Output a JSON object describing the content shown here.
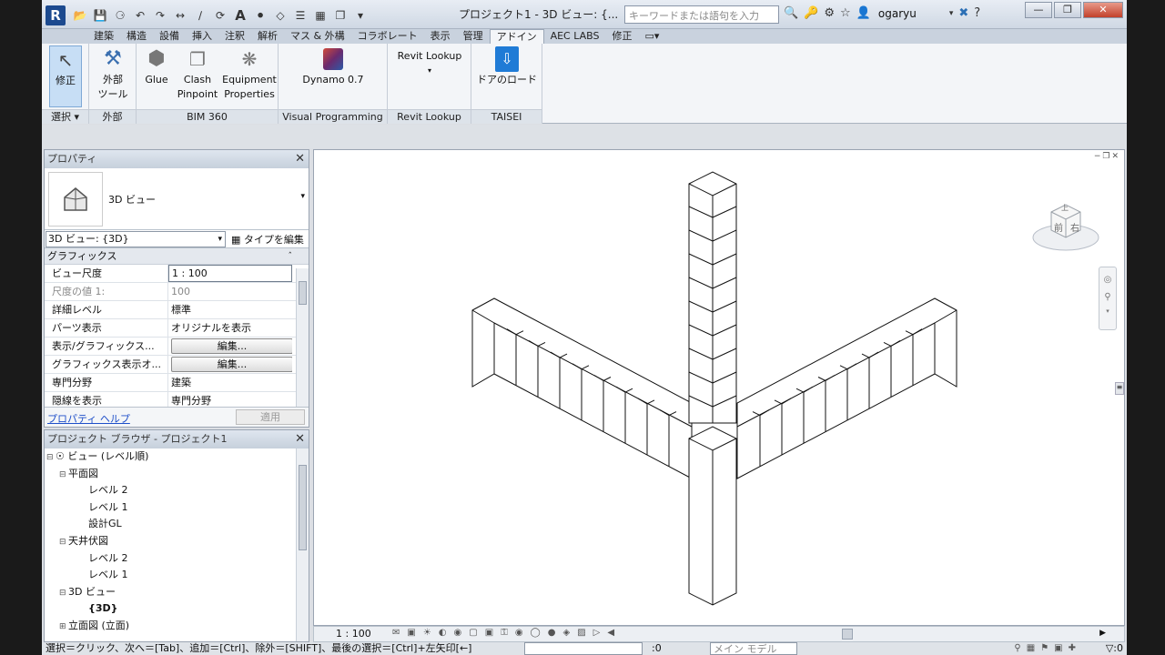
{
  "app": {
    "title": "プロジェクト1 - 3D ビュー: {...",
    "search_placeholder": "キーワードまたは語句を入力",
    "user": "ogaryu"
  },
  "tabs": [
    "建築",
    "構造",
    "設備",
    "挿入",
    "注釈",
    "解析",
    "マス & 外構",
    "コラボレート",
    "表示",
    "管理",
    "アドイン",
    "AEC LABS",
    "修正"
  ],
  "active_tab": "アドイン",
  "ribbon": {
    "select": {
      "button": "修正",
      "label": "選択"
    },
    "external": {
      "button_line1": "外部",
      "button_line2": "ツール",
      "label": "外部"
    },
    "bim360": {
      "glue": "Glue",
      "clash_line1": "Clash",
      "clash_line2": "Pinpoint",
      "equip_line1": "Equipment",
      "equip_line2": "Properties",
      "label": "BIM 360"
    },
    "visual": {
      "dynamo": "Dynamo 0.7",
      "label": "Visual Programming"
    },
    "lookup": {
      "button": "Revit Lookup",
      "label": "Revit Lookup"
    },
    "taisei": {
      "button": "ドアのロード",
      "label": "TAISEI"
    }
  },
  "properties": {
    "title": "プロパティ",
    "type_name": "3D ビュー",
    "selector": "3D ビュー: {3D}",
    "edit_type": "タイプを編集",
    "category": "グラフィックス",
    "rows": [
      {
        "key": "ビュー尺度",
        "value": "1 : 100"
      },
      {
        "key": "尺度の値    1:",
        "value": "100"
      },
      {
        "key": "詳細レベル",
        "value": "標準"
      },
      {
        "key": "パーツ表示",
        "value": "オリジナルを表示"
      },
      {
        "key": "表示/グラフィックス...",
        "value": "編集..."
      },
      {
        "key": "グラフィックス表示オ...",
        "value": "編集..."
      },
      {
        "key": "専門分野",
        "value": "建築"
      },
      {
        "key": "隠線を表示",
        "value": "専門分野"
      }
    ],
    "help_link": "プロパティ ヘルプ",
    "apply": "適用"
  },
  "browser": {
    "title": "プロジェクト ブラウザ - プロジェクト1",
    "nodes": [
      {
        "label": "ビュー (レベル順)"
      },
      {
        "label": "平面図"
      },
      {
        "label": "レベル 2"
      },
      {
        "label": "レベル 1"
      },
      {
        "label": "設計GL"
      },
      {
        "label": "天井伏図"
      },
      {
        "label": "レベル 2"
      },
      {
        "label": "レベル 1"
      },
      {
        "label": "3D ビュー"
      },
      {
        "label": "{3D}"
      },
      {
        "label": "立面図 (立面)"
      }
    ]
  },
  "viewcube": {
    "top": "上",
    "front": "前",
    "right": "右"
  },
  "view_control": {
    "scale": "1 : 100"
  },
  "status": {
    "message": "選択＝クリック、次へ＝[Tab]、追加＝[Ctrl]、除外＝[SHIFT]、最後の選択＝[Ctrl]+左矢印[←]",
    "zero": ":0",
    "model": "メイン モデル",
    "filter": ":0"
  }
}
